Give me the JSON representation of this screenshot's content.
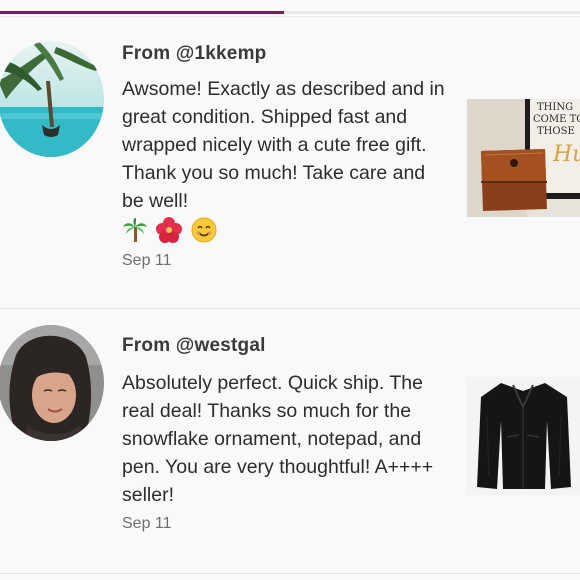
{
  "progress": {
    "fraction": 0.49
  },
  "reviews": [
    {
      "from_label": "From @1kkemp",
      "text": "Awsome! Exactly as described and in great condition. Shipped fast and wrapped nicely with a cute free gift. Thank you so much! Take care and be well!",
      "emojis": [
        "palm-tree-icon",
        "hibiscus-icon",
        "smiling-face-icon"
      ],
      "date": "Sep 11",
      "thumbnail_sign_text": [
        "THING",
        "COME TO",
        "THOSE",
        "Hustle"
      ]
    },
    {
      "from_label": "From @westgal",
      "text": "Absolutely perfect. Quick ship. The real deal! Thanks so much for the snowflake ornament, notepad, and pen. You are very thoughtful! A++++ seller!",
      "date": "Sep 11"
    }
  ],
  "colors": {
    "accent": "#7a1f5a",
    "background": "#faf9fa",
    "divider": "#e6e3e6"
  }
}
